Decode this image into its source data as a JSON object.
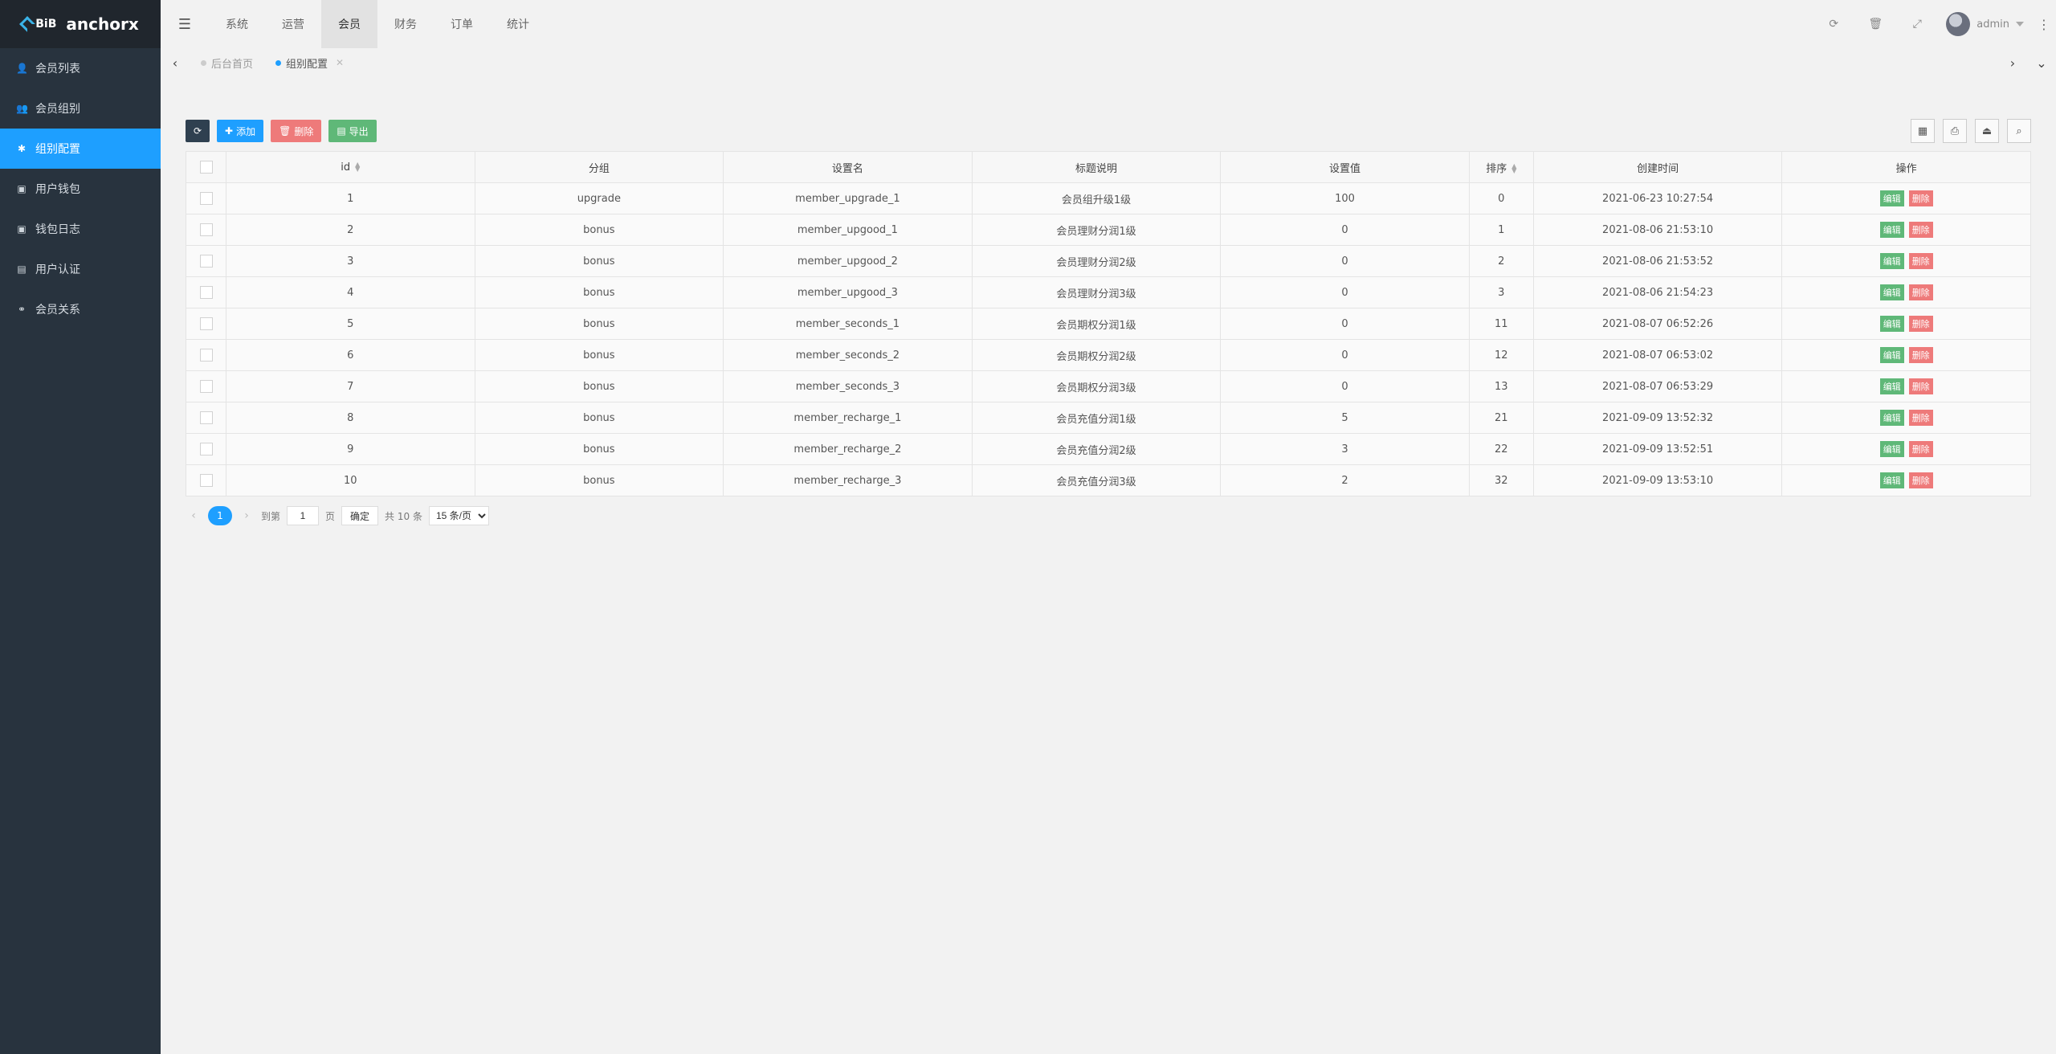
{
  "brand": {
    "mark": "BiB",
    "name": "anchorx"
  },
  "sidebar": {
    "items": [
      {
        "label": "会员列表",
        "icon": "user-icon"
      },
      {
        "label": "会员组别",
        "icon": "user-group-icon"
      },
      {
        "label": "组别配置",
        "icon": "gear-icon",
        "active": true
      },
      {
        "label": "用户钱包",
        "icon": "wallet-icon"
      },
      {
        "label": "钱包日志",
        "icon": "money-log-icon"
      },
      {
        "label": "用户认证",
        "icon": "id-card-icon"
      },
      {
        "label": "会员关系",
        "icon": "relation-icon"
      }
    ]
  },
  "topnav": {
    "items": [
      "系统",
      "运营",
      "会员",
      "财务",
      "订单",
      "统计"
    ],
    "active": "会员"
  },
  "user": {
    "name": "admin"
  },
  "tabs": [
    {
      "label": "后台首页",
      "active": false
    },
    {
      "label": "组别配置",
      "active": true
    }
  ],
  "toolbar": {
    "add_label": "添加",
    "delete_label": "删除",
    "export_label": "导出"
  },
  "table": {
    "headers": [
      "id",
      "分组",
      "设置名",
      "标题说明",
      "设置值",
      "排序",
      "创建时间",
      "操作"
    ],
    "rows": [
      [
        "1",
        "upgrade",
        "member_upgrade_1",
        "会员组升级1级",
        "100",
        "0",
        "2021-06-23 10:27:54"
      ],
      [
        "2",
        "bonus",
        "member_upgood_1",
        "会员理财分润1级",
        "0",
        "1",
        "2021-08-06 21:53:10"
      ],
      [
        "3",
        "bonus",
        "member_upgood_2",
        "会员理财分润2级",
        "0",
        "2",
        "2021-08-06 21:53:52"
      ],
      [
        "4",
        "bonus",
        "member_upgood_3",
        "会员理财分润3级",
        "0",
        "3",
        "2021-08-06 21:54:23"
      ],
      [
        "5",
        "bonus",
        "member_seconds_1",
        "会员期权分润1级",
        "0",
        "11",
        "2021-08-07 06:52:26"
      ],
      [
        "6",
        "bonus",
        "member_seconds_2",
        "会员期权分润2级",
        "0",
        "12",
        "2021-08-07 06:53:02"
      ],
      [
        "7",
        "bonus",
        "member_seconds_3",
        "会员期权分润3级",
        "0",
        "13",
        "2021-08-07 06:53:29"
      ],
      [
        "8",
        "bonus",
        "member_recharge_1",
        "会员充值分润1级",
        "5",
        "21",
        "2021-09-09 13:52:32"
      ],
      [
        "9",
        "bonus",
        "member_recharge_2",
        "会员充值分润2级",
        "3",
        "22",
        "2021-09-09 13:52:51"
      ],
      [
        "10",
        "bonus",
        "member_recharge_3",
        "会员充值分润3级",
        "2",
        "32",
        "2021-09-09 13:53:10"
      ]
    ],
    "op_edit": "编辑",
    "op_delete": "删除"
  },
  "pager": {
    "current": "1",
    "goto_label": "到第",
    "goto_value": "1",
    "page_unit": "页",
    "confirm_label": "确定",
    "total_label": "共 10 条",
    "page_size": "15 条/页"
  }
}
